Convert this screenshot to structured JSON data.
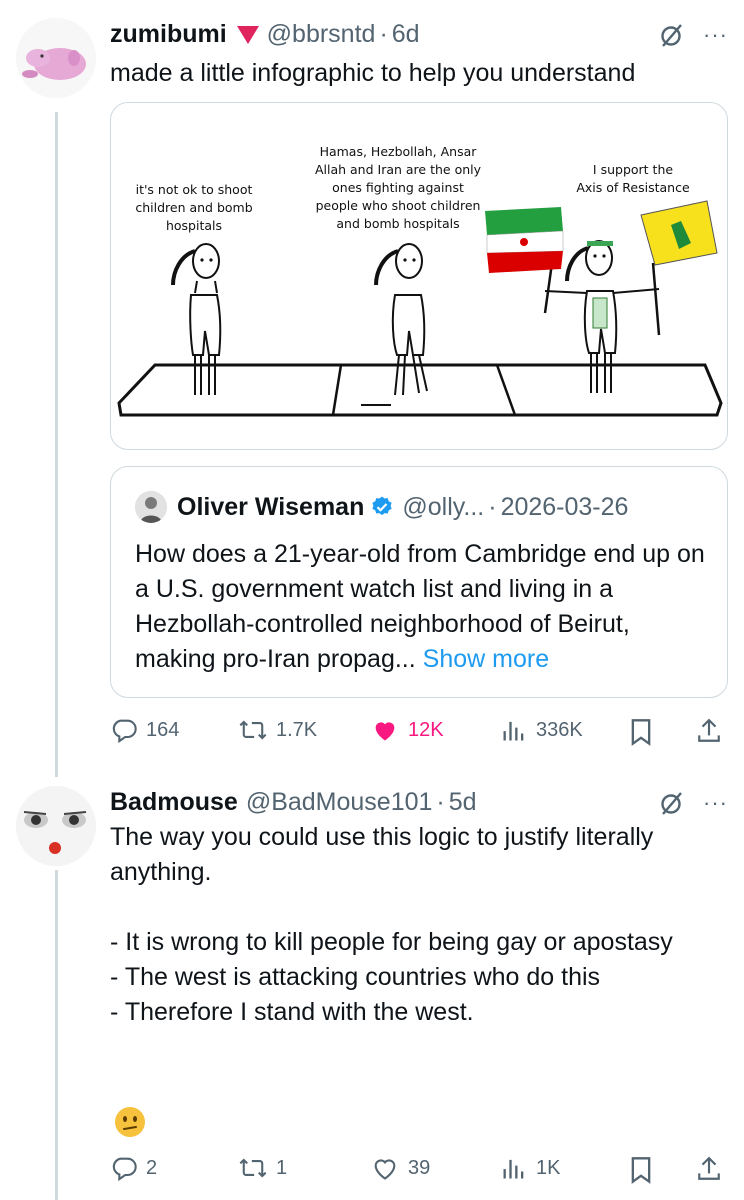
{
  "post1": {
    "name": "zumibumi",
    "handle": "@bbrsntd",
    "time": "6d",
    "text": "made a little infographic to help you understand",
    "image": {
      "caption_left": "it's not ok to shoot\nchildren and bomb\nhospitals",
      "caption_middle": "Hamas, Hezbollah, Ansar\nAllah and Iran are the only\nones fighting against\npeople who shoot children\nand bomb hospitals",
      "caption_right": "I support the\nAxis of Resistance"
    },
    "quote": {
      "name": "Oliver Wiseman",
      "handle": "@olly...",
      "time": "2026-03-26",
      "text": "How does a 21-year-old from Cambridge end up on a U.S. government watch list and living in a Hezbollah-controlled neighborhood of Beirut, making pro-Iran propag...",
      "show_more": "Show more"
    },
    "stats": {
      "replies": "164",
      "reposts": "1.7K",
      "likes": "12K",
      "views": "336K"
    },
    "dot": "·",
    "more": "···"
  },
  "post2": {
    "name": "Badmouse",
    "handle": "@BadMouse101",
    "time": "5d",
    "text": "The way you could use this logic to justify literally anything.\n\n- It is wrong to kill people for being gay or apostasy\n- The west is attacking countries who do this\n- Therefore I stand with the west.",
    "stats": {
      "replies": "2",
      "reposts": "1",
      "likes": "39",
      "views": "1K"
    },
    "dot": "·",
    "more": "···"
  },
  "colors": {
    "accent": "#1d9bf0",
    "like": "#f91880",
    "muted": "#536471",
    "border": "#cfd9de"
  },
  "icons": [
    "grok-icon",
    "reply-icon",
    "repost-icon",
    "like-icon",
    "views-icon",
    "bookmark-icon",
    "share-icon",
    "verified-icon",
    "confused-face-emoji"
  ]
}
